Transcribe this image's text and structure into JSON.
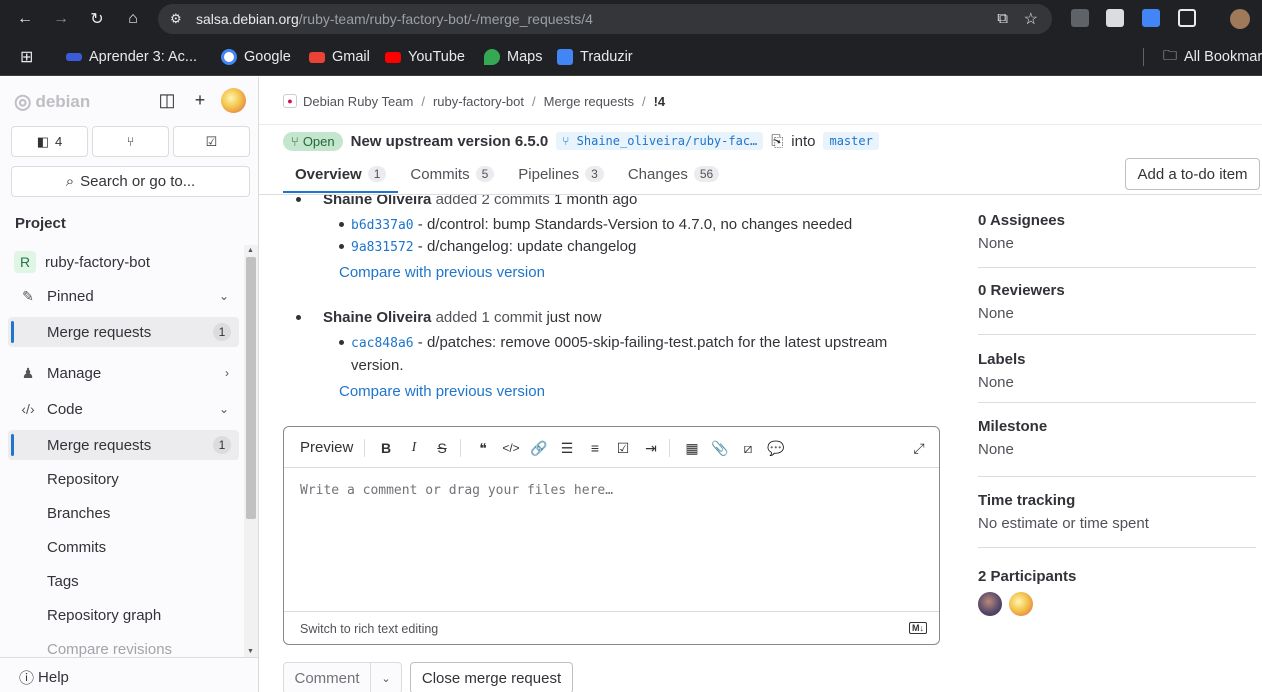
{
  "browser": {
    "url_host": "salsa.debian.org",
    "url_path": "/ruby-team/ruby-factory-bot/-/merge_requests/4",
    "bookmarks": [
      {
        "label": "Aprender 3: Ac...",
        "color": "#3b5bdb"
      },
      {
        "label": "Google",
        "color": "#ffffff"
      },
      {
        "label": "Gmail",
        "color": "#ea4335"
      },
      {
        "label": "YouTube",
        "color": "#ff0000"
      },
      {
        "label": "Maps",
        "color": "#34a853"
      },
      {
        "label": "Traduzir",
        "color": "#4285f4"
      }
    ],
    "all_bookmarks": "All Bookmarks"
  },
  "sidebar": {
    "logo": "debian",
    "todo_count": "4",
    "search_label": "Search or go to...",
    "section": "Project",
    "project_initial": "R",
    "project_name": "ruby-factory-bot",
    "pinned": "Pinned",
    "pinned_mr": "Merge requests",
    "pinned_mr_count": "1",
    "manage": "Manage",
    "code": "Code",
    "code_mr": "Merge requests",
    "code_mr_count": "1",
    "repository": "Repository",
    "branches": "Branches",
    "commits": "Commits",
    "tags": "Tags",
    "repo_graph": "Repository graph",
    "compare": "Compare revisions",
    "help": "Help"
  },
  "breadcrumb": {
    "group": "Debian Ruby Team",
    "project": "ruby-factory-bot",
    "section": "Merge requests",
    "current": "!4"
  },
  "mr": {
    "status": "Open",
    "title": "New upstream version 6.5.0",
    "source_branch": "Shaine_oliveira/ruby-fac…",
    "into": "into",
    "target_branch": "master"
  },
  "tabs": [
    {
      "label": "Overview",
      "count": "1"
    },
    {
      "label": "Commits",
      "count": "5"
    },
    {
      "label": "Pipelines",
      "count": "3"
    },
    {
      "label": "Changes",
      "count": "56"
    }
  ],
  "todo_button": "Add a to-do item",
  "activity": {
    "entry1": {
      "author": "Shaine Oliveira",
      "action": "added 2 commits",
      "time": "1 month ago"
    },
    "commits1": [
      {
        "sha": "b6d337a0",
        "msg": "- d/control: bump Standards-Version to 4.7.0, no changes needed"
      },
      {
        "sha": "9a831572",
        "msg": "- d/changelog: update changelog"
      }
    ],
    "compare1": "Compare with previous version",
    "entry2": {
      "author": "Shaine Oliveira",
      "action": "added 1 commit",
      "time": "just now"
    },
    "commit2": {
      "sha": "cac848a6",
      "msg_line1": "- d/patches: remove 0005-skip-failing-test.patch for the latest upstream",
      "msg_line2": "version."
    },
    "compare2": "Compare with previous version"
  },
  "editor": {
    "preview": "Preview",
    "placeholder": "Write a comment or drag your files here…",
    "rich_text": "Switch to rich text editing",
    "md_badge": "M↓"
  },
  "actions": {
    "comment": "Comment",
    "close_mr": "Close merge request"
  },
  "right_sidebar": {
    "assignees_title": "0 Assignees",
    "assignees_val": "None",
    "reviewers_title": "0 Reviewers",
    "reviewers_val": "None",
    "labels_title": "Labels",
    "labels_val": "None",
    "milestone_title": "Milestone",
    "milestone_val": "None",
    "time_title": "Time tracking",
    "time_val": "No estimate or time spent",
    "participants_title": "2 Participants"
  }
}
